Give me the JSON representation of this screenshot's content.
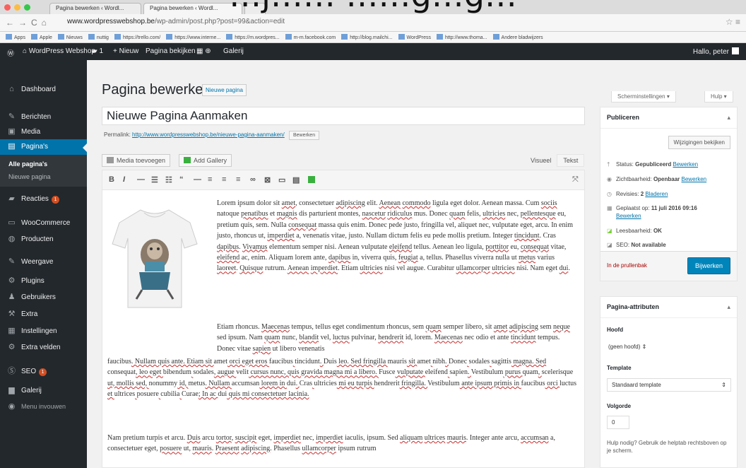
{
  "caption": "…j…… ……g…g…",
  "browser": {
    "tabs": [
      "Pagina bewerken ‹ Wordl...",
      "Pagina bewerken ‹ Wordl..."
    ],
    "url_domain": "www.wordpresswebshop.be",
    "url_path": "/wp-admin/post.php?post=99&action=edit",
    "bookmarks": [
      "Apps",
      "Apple",
      "Nieuws",
      "nuttig",
      "https://trello.com/",
      "https://www.interne...",
      "https://m.wordpres...",
      "m-m.facebook.com",
      "http://blog.mailchi...",
      "WordPress",
      "http://www.thoma...",
      "Andere bladwijzers"
    ]
  },
  "adminbar": {
    "site_name": "WordPress Webshop",
    "comments_count": "1",
    "new_label": "+ Nieuw",
    "view_page": "Pagina bekijken",
    "gallery": "Galerij",
    "greeting": "Hallo, peter"
  },
  "sidebar": {
    "items": [
      {
        "label": "Dashboard",
        "icon": "dashboard-icon"
      },
      {
        "label": "Berichten",
        "icon": "pin-icon"
      },
      {
        "label": "Media",
        "icon": "media-icon"
      },
      {
        "label": "Pagina's",
        "icon": "page-icon"
      },
      {
        "label": "Reacties",
        "icon": "comment-icon",
        "badge": "1"
      },
      {
        "label": "WooCommerce",
        "icon": "woocommerce-icon"
      },
      {
        "label": "Producten",
        "icon": "product-icon"
      },
      {
        "label": "Weergave",
        "icon": "brush-icon"
      },
      {
        "label": "Plugins",
        "icon": "plugin-icon"
      },
      {
        "label": "Gebruikers",
        "icon": "users-icon"
      },
      {
        "label": "Extra",
        "icon": "tools-icon"
      },
      {
        "label": "Instellingen",
        "icon": "settings-icon"
      },
      {
        "label": "Extra velden",
        "icon": "fields-icon"
      },
      {
        "label": "SEO",
        "icon": "seo-icon",
        "badge": "1"
      },
      {
        "label": "Galerij",
        "icon": "gallery-icon"
      },
      {
        "label": "Menu invouwen",
        "icon": "collapse-icon"
      }
    ],
    "submenu": [
      "Alle pagina's",
      "Nieuwe pagina"
    ]
  },
  "main": {
    "page_title": "Pagina bewerken",
    "add_new": "Nieuwe pagina",
    "screen_options": "Scherminstellingen ▾",
    "help": "Hulp ▾",
    "post_title": "Nieuwe Pagina Aanmaken",
    "permalink_label": "Permalink:",
    "permalink_url": "http://www.wordpresswebshop.be/nieuwe-pagina-aanmaken/",
    "permalink_edit": "Bewerken",
    "add_media": "Media toevoegen",
    "add_gallery": "Add Gallery",
    "tab_visual": "Visueel",
    "tab_text": "Tekst"
  },
  "content": {
    "p1": [
      "Lorem ipsum dolor sit ",
      "amet",
      ", consectetuer ",
      "adipiscing",
      " elit. ",
      "Aenean",
      " ",
      "commodo",
      " ligula eget dolor. Aenean massa. Cum ",
      "sociis",
      " natoque ",
      "penatibus",
      " et ",
      "magnis",
      " dis parturient montes, ",
      "nascetur",
      " ",
      "ridiculus",
      " mus. Donec ",
      "quam",
      " felis, ",
      "ultricies",
      " nec, ",
      "pellentesque",
      " eu, pretium quis, sem. Nulla ",
      "consequat",
      " massa quis enim. Donec pede justo, fringilla vel, aliquet nec, vulputate eget, arcu. In enim justo, rhoncus ut, ",
      "imperdiet",
      " a, venenatis vitae, justo. Nullam dictum felis eu pede mollis pretium. Integer ",
      "tincidunt",
      ". Cras ",
      "dapibus",
      ". ",
      "Vivamus",
      " elementum semper nisi. Aenean vulputate ",
      "eleifend",
      " tellus. Aenean leo ligula, ",
      "porttitor",
      " eu, ",
      "consequat",
      " vitae, ",
      "eleifend",
      " ac, enim. Aliquam lorem ante, ",
      "dapibus",
      " in, viverra quis, ",
      "feugiat",
      " a, tellus. Phasellus viverra nulla ut ",
      "metus",
      " varius ",
      "laoreet",
      ". ",
      "Quisque",
      " rutrum. ",
      "Aenean",
      " ",
      "imperdiet",
      ". Etiam ",
      "ultricies",
      " nisi vel augue. Curabitur ",
      "ullamcorper",
      " ",
      "ultricies",
      " nisi. Nam eget ",
      "dui",
      "."
    ],
    "p2a": [
      "Etiam rhoncus. ",
      "Maecenas",
      " tempus, tellus eget condimentum rhoncus, sem ",
      "quam",
      " semper libero, sit ",
      "amet",
      " ",
      "adipiscing",
      " sem ",
      "neque",
      " sed ipsum. Nam ",
      "quam",
      " nunc, ",
      "blandit",
      " vel, ",
      "luctus",
      " pulvinar, ",
      "hendrerit",
      " id, lorem. ",
      "Maecenas",
      " nec odio et ante ",
      "tincidunt",
      " tempus. Donec vitae ",
      "sapien",
      " ut libero venenatis"
    ],
    "p2b": [
      "faucibus",
      ". Nullam quis ante. Etiam sit ",
      "amet",
      " orci eget eros ",
      "faucibus",
      " ",
      "tincidunt",
      ". ",
      "Duis",
      " leo. Sed fringilla ",
      "mauris",
      " sit ",
      "amet",
      " ",
      "nibh",
      ". ",
      "Donec",
      " ",
      "sodales",
      " ",
      "sagittis",
      " magna. Sed ",
      "consequat",
      ", leo eget ",
      "bibendum",
      " ",
      "sodales",
      ", augue ",
      "velit",
      " cursus nunc, quis gravida magna mi a libero. ",
      "Fusce",
      " vulputate ",
      "eleifend",
      " ",
      "sapien",
      ". ",
      "Vestibulum",
      " purus ",
      "quam",
      ", ",
      "scelerisque",
      " ut, mollis sed, ",
      "nonummy",
      " id, ",
      "metus",
      ". Nullam ",
      "accumsan",
      " lorem in ",
      "dui",
      ". ",
      "Cras",
      " ",
      "ultricies",
      " mi eu turpis ",
      "hendrerit",
      " fringilla. ",
      "Vestibulum",
      " ante ipsum primis in ",
      "faucibus",
      " orci ",
      "luctus",
      " et ",
      "ultrices",
      " ",
      "posuere",
      " ",
      "cubilia",
      " ",
      "Curae",
      "; In ac ",
      "dui",
      " quis mi consectetuer lacinia."
    ],
    "p3": [
      "Nam pretium turpis et arcu. ",
      "Duis",
      " arcu ",
      "tortor",
      ", ",
      "suscipit",
      " eget, ",
      "imperdiet",
      " nec, ",
      "imperdiet",
      " iaculis, ipsum. Sed ",
      "aliquam",
      " ",
      "ultrices",
      " ",
      "mauris",
      ". Integer ante arcu, ",
      "accumsan",
      " a, consectetuer eget, ",
      "posuere",
      " ut, ",
      "mauris",
      ". ",
      "Praesent",
      " ",
      "adipiscing",
      ". Phasellus ",
      "ullamcorper",
      " ipsum rutrum"
    ]
  },
  "publish": {
    "title": "Publiceren",
    "preview": "Wijzigingen bekijken",
    "status_label": "Status:",
    "status_value": "Gepubliceerd",
    "visibility_label": "Zichtbaarheid:",
    "visibility_value": "Openbaar",
    "revisions_label": "Revisies:",
    "revisions_value": "2",
    "revisions_link": "Bladeren",
    "published_label": "Geplaatst op:",
    "published_value": "11 juli 2016 09:16",
    "edit_link": "Bewerken",
    "readability_label": "Leesbaarheid:",
    "readability_value": "OK",
    "seo_label": "SEO:",
    "seo_value": "Not available",
    "trash": "In de prullenbak",
    "update": "Bijwerken"
  },
  "attributes": {
    "title": "Pagina-attributen",
    "parent_label": "Hoofd",
    "parent_value": "(geen hoofd) ⇕",
    "template_label": "Template",
    "template_value": "Standaard template",
    "order_label": "Volgorde",
    "order_value": "0",
    "help_text": "Hulp nodig? Gebruik de helptab rechtsboven op je scherm."
  },
  "colors": {
    "admin_dark": "#23282d",
    "accent_blue": "#0073aa",
    "update_blue": "#0085ba",
    "badge_orange": "#d54e21",
    "gallery_green": "#3ab03e"
  }
}
